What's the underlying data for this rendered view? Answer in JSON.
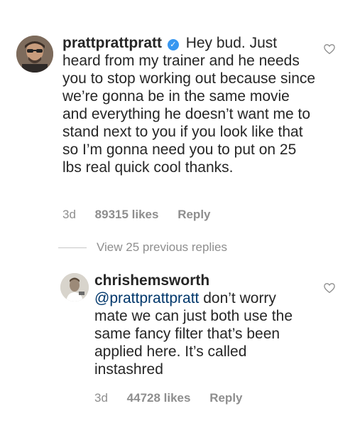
{
  "comments": [
    {
      "username": "prattprattpratt",
      "verified": true,
      "text": "Hey bud. Just heard from my trainer and he needs you to stop working out because since we’re gonna be in the same movie and everything he doesn’t want me to stand next to you if you look like that so I’m gonna need you to put on 25 lbs real quick cool thanks.",
      "time": "3d",
      "likes": "89315 likes",
      "reply_label": "Reply"
    },
    {
      "username": "chrishemsworth",
      "mention": "@prattprattpratt",
      "text": " don’t worry mate we can just both use the same fancy filter that’s been applied here. It’s called instashred",
      "time": "3d",
      "likes": "44728 likes",
      "reply_label": "Reply"
    }
  ],
  "view_replies_label": "View 25 previous replies",
  "icons": {
    "like": "heart-outline-icon",
    "verified": "verified-check-icon"
  },
  "colors": {
    "text": "#262626",
    "meta": "#8e8e8e",
    "mention": "#00376b",
    "verified": "#3897f0"
  }
}
